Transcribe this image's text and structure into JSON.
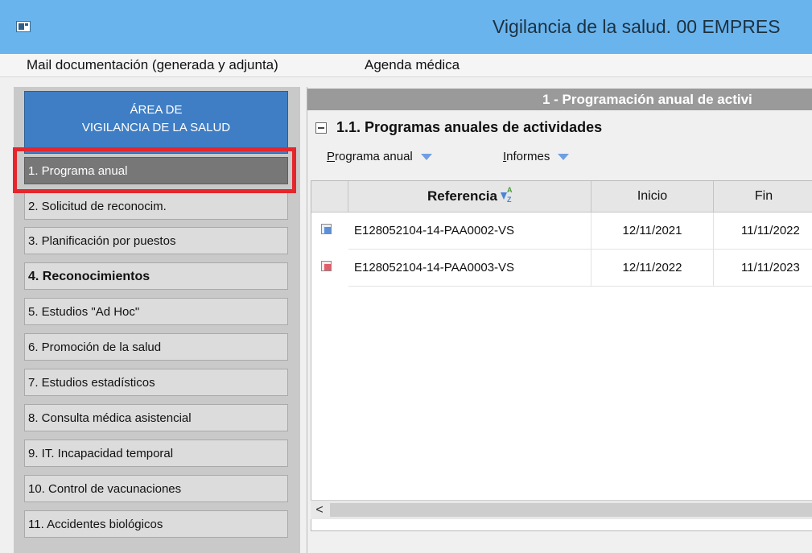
{
  "window": {
    "title": "Vigilancia de la salud.  00 EMPRES"
  },
  "menu": {
    "items": [
      "Mail documentación (generada y adjunta)",
      "Agenda médica"
    ]
  },
  "sidebar": {
    "area_title_line1": "ÁREA DE",
    "area_title_line2": "VIGILANCIA DE LA SALUD",
    "items": [
      {
        "label": "1. Programa anual",
        "active": true
      },
      {
        "label": "2. Solicitud de reconocim."
      },
      {
        "label": "3. Planificación por puestos"
      },
      {
        "label": "4. Reconocimientos",
        "bold": true
      },
      {
        "label": "5. Estudios \"Ad Hoc\""
      },
      {
        "label": "6. Promoción de la salud"
      },
      {
        "label": "7. Estudios estadísticos"
      },
      {
        "label": "8. Consulta médica asistencial"
      },
      {
        "label": "9. IT. Incapacidad temporal"
      },
      {
        "label": "10. Control de vacunaciones"
      },
      {
        "label": "11. Accidentes biológicos"
      }
    ]
  },
  "panel": {
    "header": "1 - Programación anual de activi",
    "section_title": "1.1. Programas anuales de actividades",
    "toolbar": {
      "programa_hotkey": "P",
      "programa_rest": "rograma anual",
      "informes_hotkey": "I",
      "informes_rest": "nformes"
    },
    "columns": {
      "referencia": "Referencia",
      "inicio": "Inicio",
      "fin": "Fin"
    },
    "rows": [
      {
        "referencia": "E128052104-14-PAA0002-VS",
        "inicio": "12/11/2021",
        "fin": "11/11/2022",
        "status_color": "#5b8fd8"
      },
      {
        "referencia": "E128052104-14-PAA0003-VS",
        "inicio": "12/11/2022",
        "fin": "11/11/2023",
        "status_color": "#e05d6a"
      }
    ],
    "scroll_left_glyph": "<"
  },
  "colors": {
    "titlebar": "#6ab4ee",
    "area_header": "#3f7ec4",
    "highlight": "#e6262d",
    "active_item": "#777777"
  }
}
